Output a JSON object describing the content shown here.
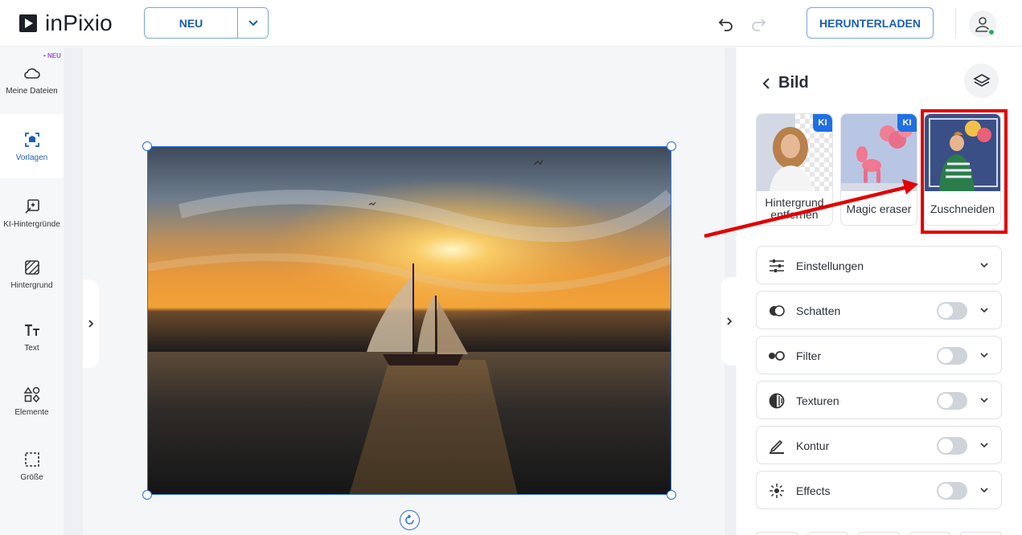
{
  "brand": {
    "name": "inPixio"
  },
  "toolbar": {
    "new_label": "NEU",
    "download_label": "HERUNTERLADEN"
  },
  "sidebar": {
    "new_badge": "• NEU",
    "items": [
      {
        "label": "Meine Dateien",
        "icon": "cloud-icon"
      },
      {
        "label": "Vorlagen",
        "icon": "template-icon",
        "active": true
      },
      {
        "label": "KI-Hintergründe",
        "icon": "ai-background-icon"
      },
      {
        "label": "Hintergrund",
        "icon": "background-icon"
      },
      {
        "label": "Text",
        "icon": "text-icon"
      },
      {
        "label": "Elemente",
        "icon": "elements-icon"
      },
      {
        "label": "Größe",
        "icon": "resize-icon"
      }
    ]
  },
  "panel": {
    "title": "Bild",
    "cards": [
      {
        "label": "Hintergrund entfernen",
        "badge": "KI"
      },
      {
        "label": "Magic eraser",
        "badge": "KI"
      },
      {
        "label": "Zuschneiden",
        "badge": ""
      }
    ],
    "sections": [
      {
        "label": "Einstellungen",
        "toggle": false
      },
      {
        "label": "Schatten",
        "toggle": true
      },
      {
        "label": "Filter",
        "toggle": true
      },
      {
        "label": "Texturen",
        "toggle": true
      },
      {
        "label": "Kontur",
        "toggle": true
      },
      {
        "label": "Effects",
        "toggle": true
      }
    ]
  },
  "colors": {
    "accent": "#1c5fae",
    "selection": "#2a6fdb",
    "ki_badge": "#1f6fe5",
    "annotation_red": "#e30000"
  }
}
